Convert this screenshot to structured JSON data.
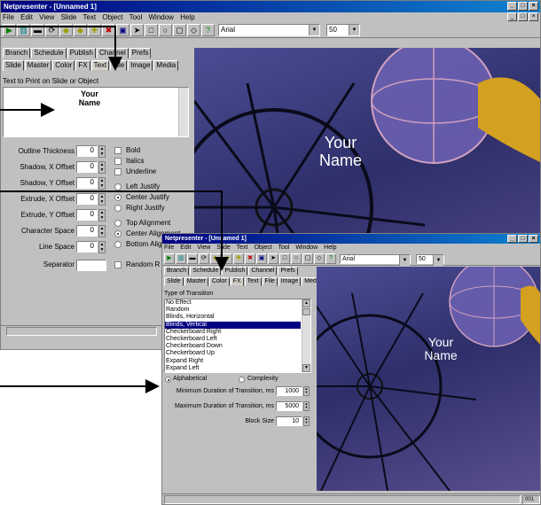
{
  "back_window": {
    "title": "Netpresenter - [Unnamed 1]",
    "menu": [
      "File",
      "Edit",
      "View",
      "Slide",
      "Text",
      "Object",
      "Tool",
      "Window",
      "Help"
    ],
    "font_name": "Arial",
    "font_size": "50",
    "tabs_row1": [
      "Branch",
      "Schedule",
      "Publish",
      "Channel",
      "Prefs"
    ],
    "tabs_row2": [
      "Slide",
      "Master",
      "Color",
      "FX",
      "Text",
      "File",
      "Image",
      "Media"
    ],
    "text_label": "Text to Print on Slide or Object",
    "text_value_line1": "Your",
    "text_value_line2": "Name",
    "fields": [
      {
        "label": "Outline Thickness",
        "value": "0"
      },
      {
        "label": "Shadow, X Offset",
        "value": "0"
      },
      {
        "label": "Shadow, Y Offset",
        "value": "0"
      },
      {
        "label": "Extrude, X Offset",
        "value": "0"
      },
      {
        "label": "Extrude, Y Offset",
        "value": "0"
      },
      {
        "label": "Character Space",
        "value": "0"
      },
      {
        "label": "Line Space",
        "value": "0"
      }
    ],
    "separator_label": "Separator",
    "checks": [
      "Bold",
      "Italics",
      "Underline"
    ],
    "justify": [
      "Left Justify",
      "Center Justify",
      "Right Justify"
    ],
    "align": [
      "Top Alignment",
      "Center Alignment",
      "Bottom Alig"
    ],
    "random_label": "Random R",
    "slide_line1": "Your",
    "slide_line2": "Name"
  },
  "front_window": {
    "title": "Netpresenter - [Unnamed 1]",
    "menu": [
      "File",
      "Edit",
      "View",
      "Slide",
      "Text",
      "Object",
      "Tool",
      "Window",
      "Help"
    ],
    "font_name": "Arial",
    "font_size": "50",
    "tabs_row1": [
      "Branch",
      "Schedule",
      "Publish",
      "Channel",
      "Prefs"
    ],
    "tabs_row2": [
      "Slide",
      "Master",
      "Color",
      "FX",
      "Text",
      "File",
      "Image",
      "Media"
    ],
    "transition_label": "Type of Transition",
    "transitions": [
      "No Effect",
      "Random",
      "Blinds, Horizontal",
      "Blinds, Vertical",
      "Checkerboard Right",
      "Checkerboard Left",
      "Checkerboard Down",
      "Checkerboard Up",
      "Expand Right",
      "Expand Left"
    ],
    "selected_transition": "Blinds, Vertical",
    "sort_alpha": "Alphabetical",
    "sort_complex": "Complexity",
    "min_label": "Minimum Duration of Transition, ms",
    "min_value": "1000",
    "max_label": "Maximum Duration of Transition, ms",
    "max_value": "5000",
    "block_label": "Block Size",
    "block_value": "10",
    "slide_line1": "Your",
    "slide_line2": "Name",
    "status_page": "001"
  },
  "colors": {
    "title_bar": "#000080",
    "selection": "#000080",
    "arrow": "#000000"
  }
}
